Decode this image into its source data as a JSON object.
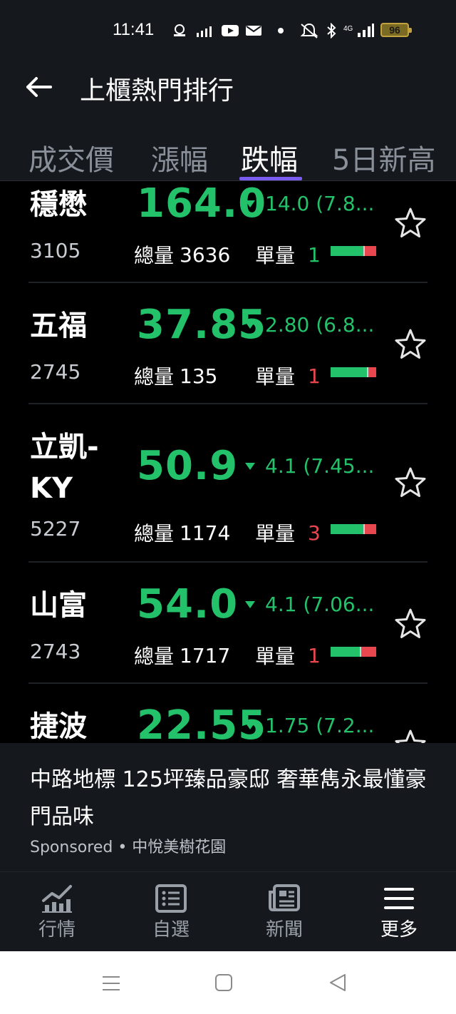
{
  "status_bar": {
    "time": "11:41",
    "battery": "96"
  },
  "header": {
    "title": "上櫃熱門排行",
    "tabs": [
      {
        "label": "成交價",
        "active": false
      },
      {
        "label": "漲幅",
        "active": false
      },
      {
        "label": "跌幅",
        "active": true
      },
      {
        "label": "5日新高",
        "active": false
      }
    ]
  },
  "labels": {
    "total_volume": "總量",
    "unit_volume": "單量"
  },
  "rows": [
    {
      "name": "穩懋",
      "code": "3105",
      "price": "164.0",
      "change": "14.0 (7.8...",
      "total_volume": "3636",
      "unit_volume": "1",
      "unit_color": "#23c26a",
      "buy_ratio": 0.72
    },
    {
      "name": "五福",
      "code": "2745",
      "price": "37.85",
      "change": "2.80 (6.8...",
      "total_volume": "135",
      "unit_volume": "1",
      "unit_color": "#e8474f",
      "buy_ratio": 0.8
    },
    {
      "name_line1": "立凱-",
      "name_line2": "KY",
      "code": "5227",
      "price": "50.9",
      "change": "4.1 (7.45...",
      "total_volume": "1174",
      "unit_volume": "3",
      "unit_color": "#e8474f",
      "buy_ratio": 0.72
    },
    {
      "name": "山富",
      "code": "2743",
      "price": "54.0",
      "change": "4.1 (7.06...",
      "total_volume": "1717",
      "unit_volume": "1",
      "unit_color": "#e8474f",
      "buy_ratio": 0.64
    },
    {
      "name": "捷波",
      "price": "22.55",
      "change": "1.75 (7.2..."
    }
  ],
  "ad": {
    "title": "中路地標 125坪臻品豪邸 奢華雋永最懂豪門品味",
    "sponsored": "Sponsored",
    "advertiser": "中悅美樹花園"
  },
  "bottom_nav": [
    {
      "label": "行情",
      "icon": "chart-icon",
      "active": false
    },
    {
      "label": "自選",
      "icon": "list-icon",
      "active": false
    },
    {
      "label": "新聞",
      "icon": "news-icon",
      "active": false
    },
    {
      "label": "更多",
      "icon": "menu-icon",
      "active": true
    }
  ],
  "colors": {
    "up_green": "#23c26a",
    "down_red": "#e8474f",
    "accent": "#7b5cf0",
    "panel": "#15191e"
  }
}
